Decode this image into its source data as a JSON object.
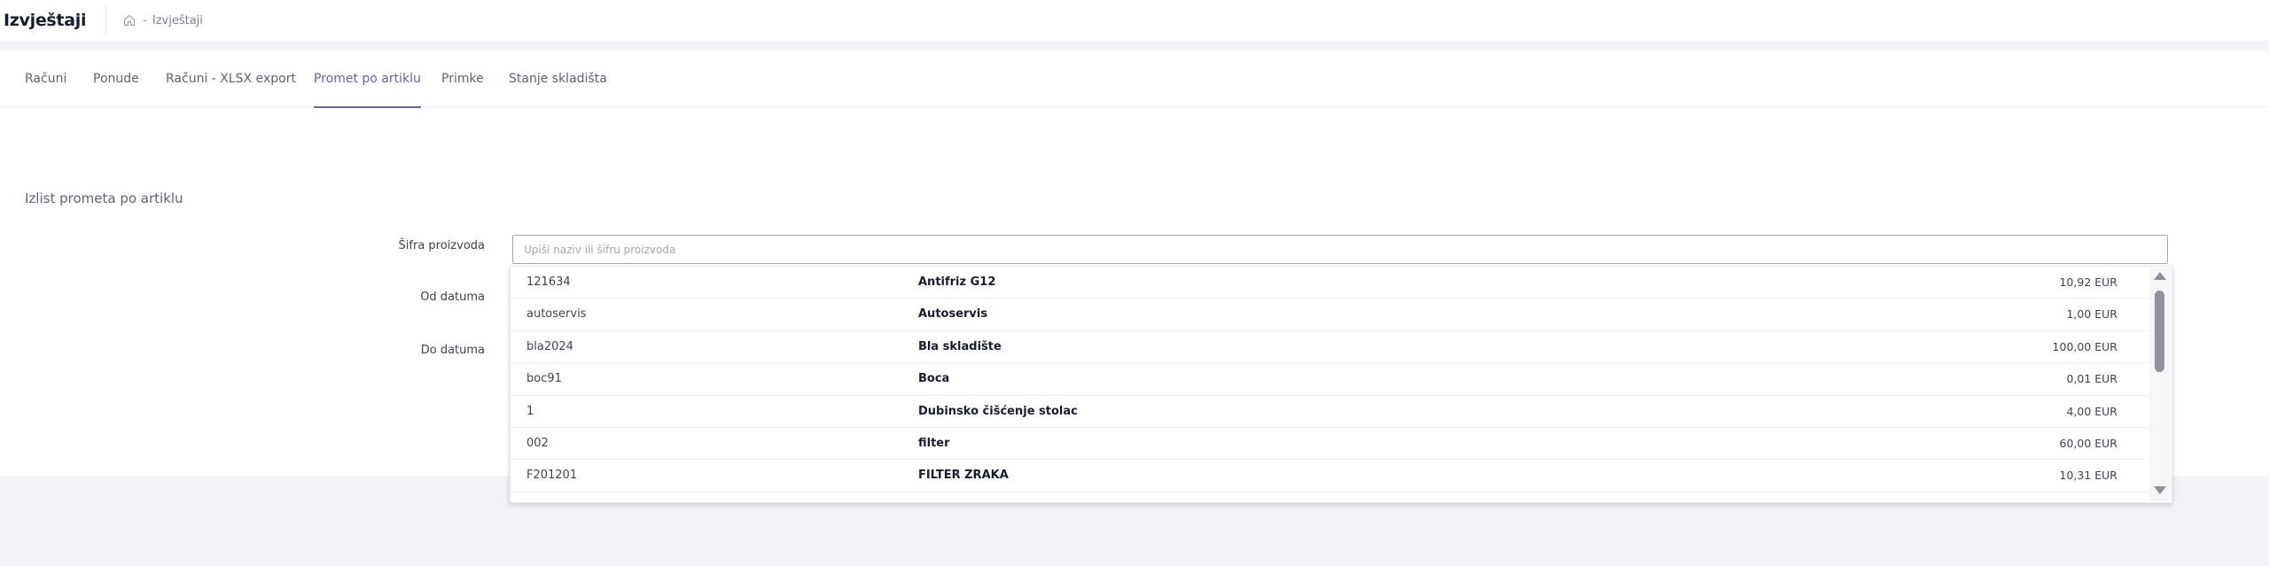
{
  "header": {
    "title": "Izvještaji",
    "breadcrumb": {
      "home_icon": "home-icon",
      "separator": "-",
      "current": "Izvještaji"
    }
  },
  "tabs": [
    {
      "label": "Računi",
      "active": false
    },
    {
      "label": "Ponude",
      "active": false
    },
    {
      "label": "Računi - XLSX export",
      "active": false
    },
    {
      "label": "Promet po artiklu",
      "active": true
    },
    {
      "label": "Primke",
      "active": false
    },
    {
      "label": "Stanje skladišta",
      "active": false
    }
  ],
  "section": {
    "title": "Izlist prometa po artiklu"
  },
  "form": {
    "product_code_label": "Šifra proizvoda",
    "product_code_value": "",
    "product_code_placeholder": "Upiši naziv ili šifru proizvoda",
    "from_date_label": "Od datuma",
    "to_date_label": "Do datuma"
  },
  "dropdown": {
    "items": [
      {
        "code": "121634",
        "name": "Antifriz G12",
        "price": "10,92 EUR"
      },
      {
        "code": "autoservis",
        "name": "Autoservis",
        "price": "1,00 EUR"
      },
      {
        "code": "bla2024",
        "name": "Bla skladište",
        "price": "100,00 EUR"
      },
      {
        "code": "boc91",
        "name": "Boca",
        "price": "0,01 EUR"
      },
      {
        "code": "1",
        "name": "Dubinsko čišćenje stolac",
        "price": "4,00 EUR"
      },
      {
        "code": "002",
        "name": "filter",
        "price": "60,00 EUR"
      },
      {
        "code": "F201201",
        "name": "FILTER ZRAKA",
        "price": "10,31 EUR"
      }
    ]
  },
  "colors": {
    "accent": "#6360b8",
    "input_border": "#a6a3de",
    "page_background": "#f3f3f7"
  }
}
